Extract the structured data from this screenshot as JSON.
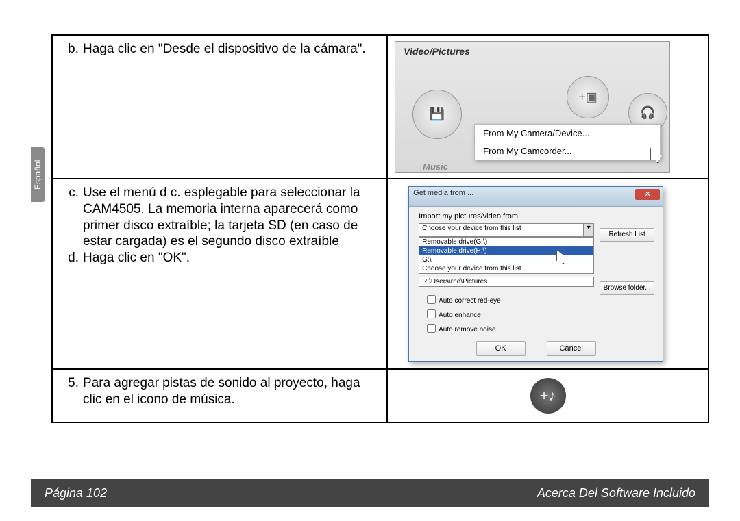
{
  "sideTab": "Español",
  "rows": [
    {
      "items": [
        {
          "label": "b.",
          "text": "Haga clic en \"Desde el dispositivo de la cámara\"."
        }
      ]
    },
    {
      "items": [
        {
          "label": "c.",
          "text": "Use el menú d c. esplegable para seleccionar la CAM4505. La memoria interna aparecerá como primer disco extraíble; la tarjeta SD (en caso de estar cargada) es el segundo disco extraíble"
        },
        {
          "label": "d.",
          "text": "Haga clic en \"OK\"."
        }
      ]
    },
    {
      "items": [
        {
          "label": "5.",
          "text": "Para agregar pistas de sonido al proyecto, haga clic en el icono de música."
        }
      ]
    }
  ],
  "shot1": {
    "tab": "Video/Pictures",
    "musicLabel": "Music",
    "menu1": "From My Camera/Device...",
    "menu2": "From My Camcorder..."
  },
  "shot2": {
    "title": "Get media from ...",
    "importLabel": "Import my pictures/video from:",
    "comboText": "Choose your device from this list",
    "list": {
      "i0": "Removable drive(G:\\)",
      "i1": "Removable drive(H:\\)",
      "i2": "G:\\",
      "i3": "Choose your device from this list"
    },
    "path": "R:\\Users\\rnd\\Pictures",
    "refresh": "Refresh List",
    "browse": "Browse folder...",
    "chk1": "Auto correct red-eye",
    "chk2": "Auto enhance",
    "chk3": "Auto remove noise",
    "ok": "OK",
    "cancel": "Cancel"
  },
  "shot3": {
    "glyph": "+♪"
  },
  "footer": {
    "left": "Página 102",
    "right": "Acerca Del Software Incluido"
  }
}
